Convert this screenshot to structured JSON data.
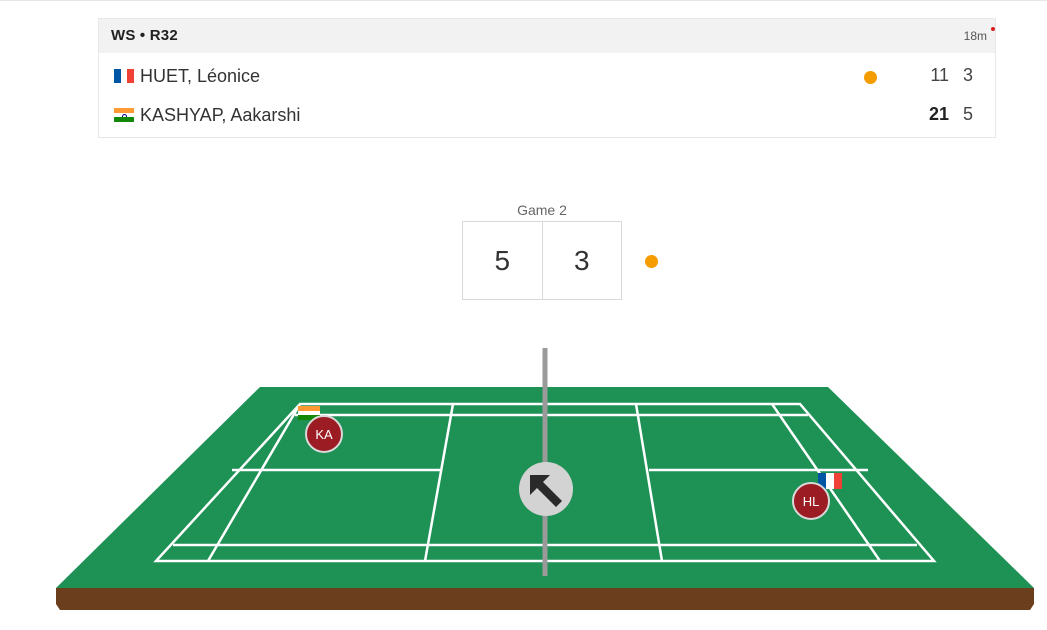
{
  "match": {
    "event": "WS • R32",
    "elapsed": "18m",
    "players": [
      {
        "name": "HUET, Léonice",
        "country": "France",
        "flag_colors": [
          "#0055A4",
          "#FFFFFF",
          "#EF4135"
        ],
        "serving": true,
        "games": [
          "11",
          "3"
        ],
        "winner_game1": false
      },
      {
        "name": "KASHYAP, Aakarshi",
        "country": "India",
        "flag_colors": [
          "#FF9933",
          "#FFFFFF",
          "#138808"
        ],
        "serving": false,
        "games": [
          "21",
          "5"
        ],
        "winner_game1": true
      }
    ]
  },
  "current_game": {
    "label": "Game 2",
    "scores": [
      "5",
      "3"
    ],
    "serve_indicator_color": "#f59c00"
  },
  "court": {
    "surface_color": "#1e9155",
    "base_color": "#6b3e1e",
    "shuttle_direction": "up-left",
    "players": [
      {
        "initials": "KA",
        "country": "India"
      },
      {
        "initials": "HL",
        "country": "France"
      }
    ]
  }
}
